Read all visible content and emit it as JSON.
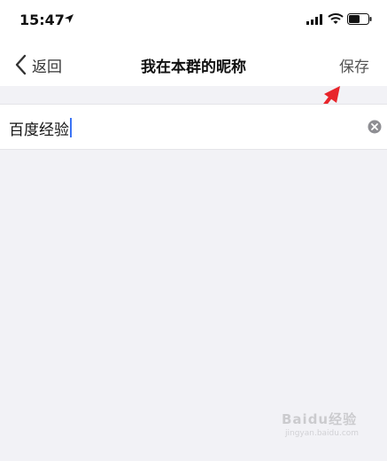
{
  "status_bar": {
    "time": "15:47",
    "icons": [
      "location-arrow-icon",
      "signal-icon",
      "wifi-icon",
      "battery-icon"
    ]
  },
  "nav": {
    "back_label": "返回",
    "title": "我在本群的昵称",
    "save_label": "保存"
  },
  "nickname_field": {
    "value": "百度经验",
    "clear_icon": "clear-icon"
  },
  "annotation": {
    "arrow_color": "#e8252b"
  },
  "watermark": {
    "text": "Baidu经验",
    "subtext": "jingyan.baidu.com"
  },
  "colors": {
    "background": "#f2f2f6",
    "bar": "#ffffff",
    "caret": "#3b73f5"
  }
}
